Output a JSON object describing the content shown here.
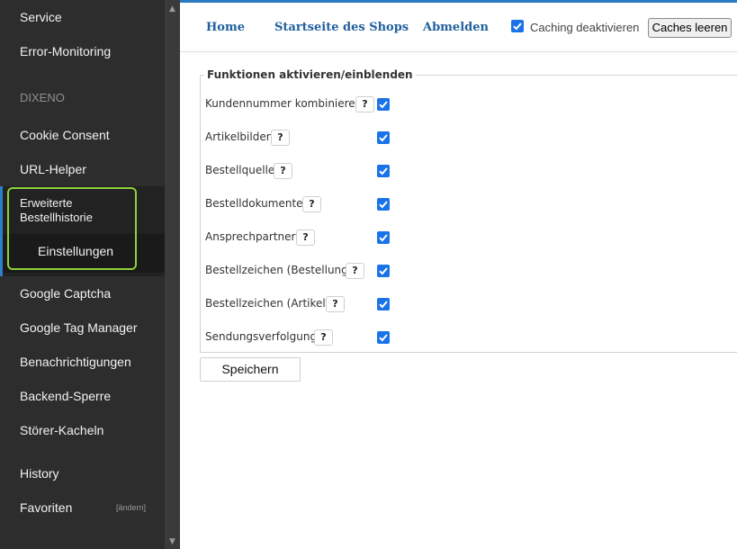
{
  "sidebar": {
    "items": [
      {
        "label": "Service"
      },
      {
        "label": "Error-Monitoring"
      },
      {
        "label": "Cookie Consent"
      },
      {
        "label": "URL-Helper"
      },
      {
        "label": "Google Captcha"
      },
      {
        "label": "Google Tag Manager"
      },
      {
        "label": "Benachrichtigungen"
      },
      {
        "label": "Backend-Sperre"
      },
      {
        "label": "Störer-Kacheln"
      },
      {
        "label": "History"
      },
      {
        "label": "Favoriten"
      }
    ],
    "section_label": "DIXENO",
    "active_item_line1": "Erweiterte",
    "active_item_line2": "Bestellhistorie",
    "active_subitem": "Einstellungen",
    "favorites_change": "[ändern]"
  },
  "topbar": {
    "links": [
      "Home",
      "Startseite des Shops",
      "Abmelden"
    ],
    "caching_label": "Caching deaktivieren",
    "caching_checked": true,
    "clear_cache_button": "Caches leeren"
  },
  "form": {
    "legend": "Funktionen aktivieren/einblenden",
    "help_symbol": "?",
    "rows": [
      {
        "label": "Kundennummer kombinieren",
        "checked": true
      },
      {
        "label": "Artikelbilder",
        "checked": true
      },
      {
        "label": "Bestellquelle",
        "checked": true
      },
      {
        "label": "Bestelldokumente",
        "checked": true
      },
      {
        "label": "Ansprechpartner",
        "checked": true
      },
      {
        "label": "Bestellzeichen (Bestellung)",
        "checked": true
      },
      {
        "label": "Bestellzeichen (Artikel)",
        "checked": true
      },
      {
        "label": "Sendungsverfolgung",
        "checked": true
      }
    ],
    "save_button": "Speichern"
  },
  "colors": {
    "sidebar_bg": "#2d2d2d",
    "accent_blue": "#2a7bc4",
    "link_blue": "#1f5f9e",
    "checkbox_blue": "#1a73e8",
    "highlight_green": "#8ed13a"
  }
}
